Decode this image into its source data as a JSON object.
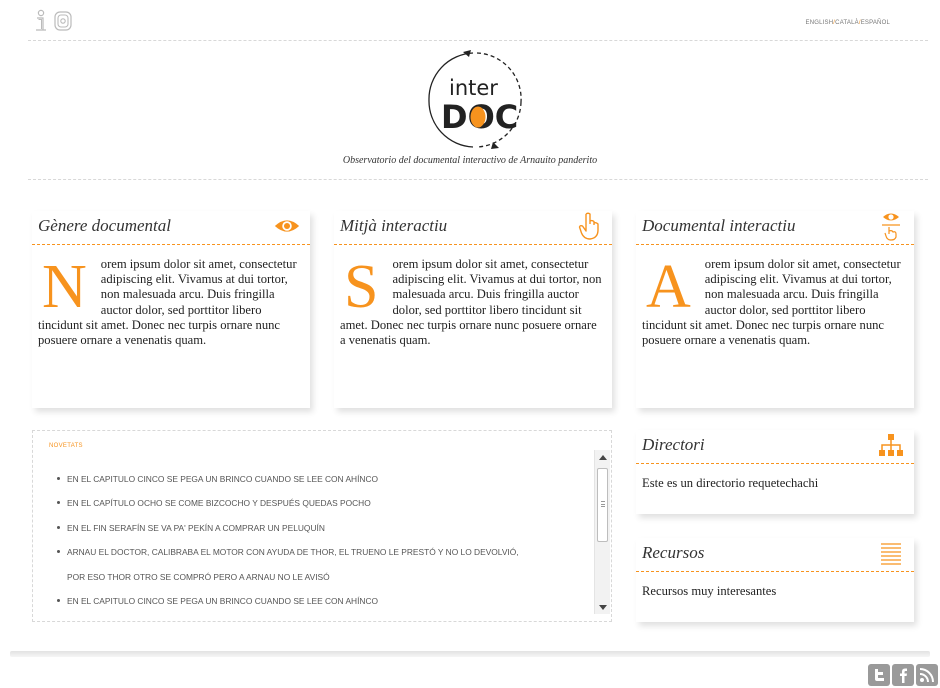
{
  "header": {
    "languages": [
      "ENGLISH",
      "CATALÀ",
      "ESPAÑOL"
    ],
    "separator": "/",
    "logo_text_top": "inter",
    "logo_text_bottom": "DOC",
    "tagline": "Observatorio del documental interactivo de Arnauito panderito"
  },
  "cards": [
    {
      "title": "Gènere documental",
      "icon": "eye-icon",
      "dropcap": "N",
      "text": "orem ipsum dolor sit amet, consectetur adipiscing elit. Vivamus at dui tortor, non malesuada arcu. Duis fringilla auctor dolor, sed porttitor libero tincidunt sit amet. Donec nec turpis ornare nunc posuere ornare a venenatis quam."
    },
    {
      "title": "Mitjà interactiu",
      "icon": "hand-pointer-icon",
      "dropcap": "S",
      "text": "orem ipsum dolor sit amet, consectetur adipiscing elit. Vivamus at dui tortor, non malesuada arcu. Duis fringilla auctor dolor, sed porttitor libero tincidunt sit amet. Donec nec turpis ornare nunc posuere ornare a venenatis quam."
    },
    {
      "title": "Documental interactiu",
      "icon": "eye-hand-icon",
      "dropcap": "A",
      "text": "orem ipsum dolor sit amet, consectetur adipiscing elit. Vivamus at dui tortor, non malesuada arcu. Duis fringilla auctor dolor, sed porttitor libero tincidunt sit amet. Donec nec turpis ornare nunc posuere ornare a venenatis quam."
    }
  ],
  "news": {
    "label": "NOVETATS",
    "items": [
      "EN EL CAPITULO CINCO SE PEGA UN BRINCO CUANDO SE LEE CON AHÍNCO",
      "EN EL CAPÍTULO OCHO SE COME BIZCOCHO Y DESPUÉS QUEDAS POCHO",
      "EN EL FIN SERAFÍN SE VA PA' PEKÍN A COMPRAR UN PELUQUÍN",
      "ARNAU EL DOCTOR, CALIBRABA EL MOTOR CON AYUDA DE THOR, EL TRUENO LE PRESTÓ Y NO LO DEVOLVIÓ,",
      "POR ESO THOR OTRO SE COMPRÓ PERO A ARNAU NO LE AVISÓ",
      "EN EL CAPITULO CINCO SE PEGA UN BRINCO CUANDO SE LEE CON AHÍNCO"
    ]
  },
  "directori": {
    "title": "Directori",
    "icon": "sitemap-icon",
    "text": "Este es un directorio requetechachi"
  },
  "recursos": {
    "title": "Recursos",
    "icon": "list-icon",
    "text": "Recursos muy interesantes"
  },
  "social": [
    "twitter-icon",
    "facebook-icon",
    "rss-icon"
  ],
  "colors": {
    "accent": "#f7931e",
    "text": "#222222",
    "muted": "#777777"
  }
}
